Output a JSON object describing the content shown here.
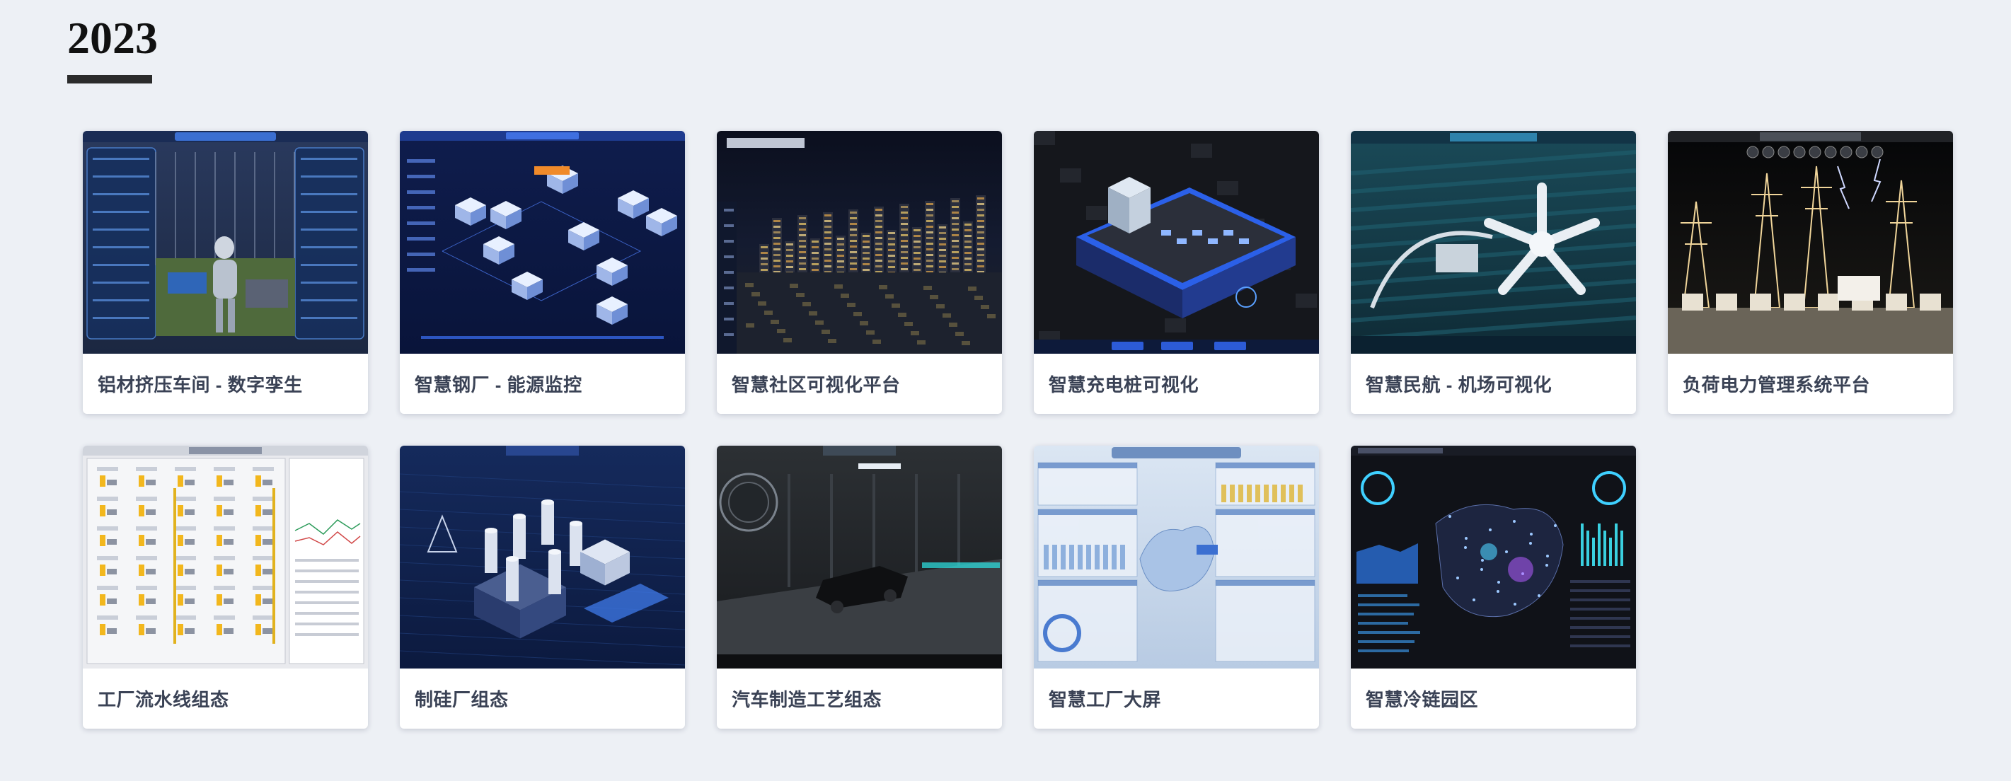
{
  "year": "2023",
  "projects": [
    {
      "title": "铝材挤压车间 - 数字孪生",
      "thumb": "aluminum-extrusion-workshop-thumbnail",
      "style": "factory"
    },
    {
      "title": "智慧钢厂 - 能源监控",
      "thumb": "steel-plant-energy-monitoring-thumbnail",
      "style": "blueprint"
    },
    {
      "title": "智慧社区可视化平台",
      "thumb": "smart-community-platform-thumbnail",
      "style": "city"
    },
    {
      "title": "智慧充电桩可视化",
      "thumb": "charging-station-visualization-thumbnail",
      "style": "platform"
    },
    {
      "title": "智慧民航 - 机场可视化",
      "thumb": "airport-visualization-thumbnail",
      "style": "airport"
    },
    {
      "title": "负荷电力管理系统平台",
      "thumb": "power-load-management-thumbnail",
      "style": "power"
    },
    {
      "title": "工厂流水线组态",
      "thumb": "factory-assembly-line-thumbnail",
      "style": "light"
    },
    {
      "title": "制硅厂组态",
      "thumb": "silicon-plant-thumbnail",
      "style": "silicon"
    },
    {
      "title": "汽车制造工艺组态",
      "thumb": "car-manufacturing-process-thumbnail",
      "style": "car"
    },
    {
      "title": "智慧工厂大屏",
      "thumb": "smart-factory-dashboard-thumbnail",
      "style": "dashboard"
    },
    {
      "title": "智慧冷链园区",
      "thumb": "cold-chain-park-thumbnail",
      "style": "map"
    }
  ]
}
